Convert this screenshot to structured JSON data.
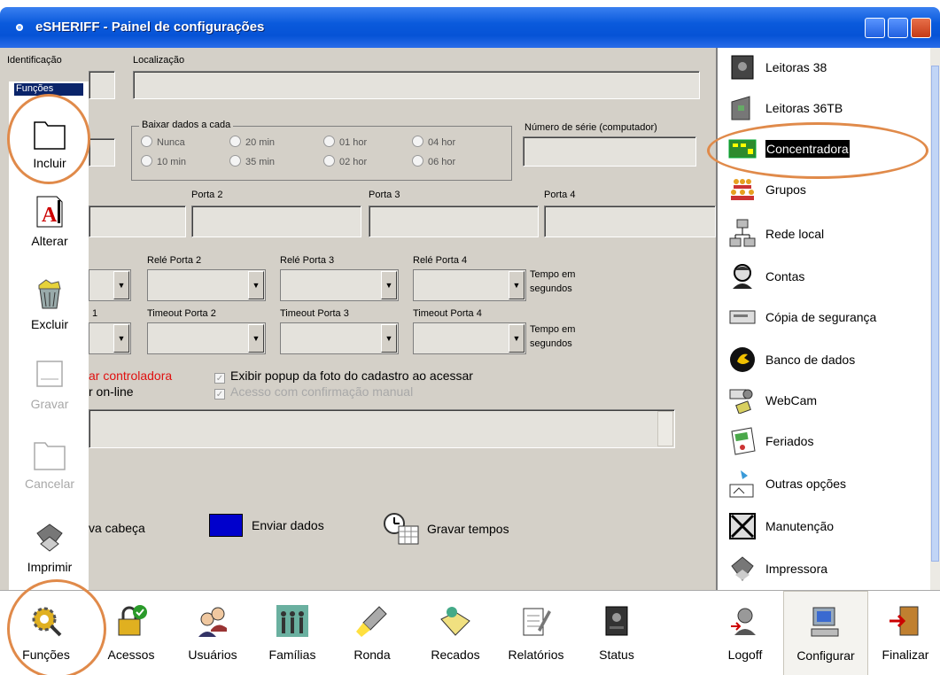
{
  "window": {
    "title": "eSHERIFF - Painel de configurações"
  },
  "form": {
    "identificacao_label": "Identificação",
    "localizacao_label": "Localização",
    "baixar_label": "Baixar dados a cada",
    "radios": [
      "Nunca",
      "20 min",
      "01 hor",
      "04 hor",
      "10 min",
      "35 min",
      "02 hor",
      "06 hor"
    ],
    "serie_label": "Número de série (computador)",
    "portas": [
      "Porta 2",
      "Porta 3",
      "Porta 4"
    ],
    "reles": [
      "Relé Porta 2",
      "Relé Porta 3",
      "Relé Porta 4"
    ],
    "timeouts_first": "1",
    "timeouts": [
      "Timeout Porta 2",
      "Timeout Porta 3",
      "Timeout Porta 4"
    ],
    "tempo_em": "Tempo em",
    "segundos": "segundos",
    "controladora_text": "ar controladora",
    "online_text": "r on-line",
    "popup_text": "Exibir popup da foto do cadastro ao acessar",
    "confirm_text": "Acesso com confirmação manual",
    "cabeca_text": "va cabeça",
    "enviar_text": "Enviar dados",
    "gravar_tempos_text": "Gravar tempos"
  },
  "functions": {
    "header": "Funções",
    "items": [
      "Incluir",
      "Alterar",
      "Excluir",
      "Gravar",
      "Cancelar",
      "Imprimir"
    ]
  },
  "right_list": [
    "Leitoras 38",
    "Leitoras 36TB",
    "Concentradora",
    "Grupos",
    "Rede local",
    "Contas",
    "Cópia de segurança",
    "Banco de dados",
    "WebCam",
    "Feriados",
    "Outras opções",
    "Manutenção",
    "Impressora"
  ],
  "bottom": [
    "Funções",
    "Acessos",
    "Usuários",
    "Famílias",
    "Ronda",
    "Recados",
    "Relatórios",
    "Status",
    "Logoff",
    "Configurar",
    "Finalizar"
  ],
  "colors": {
    "title_bar": "#0653d6",
    "panel": "#d4d0c8",
    "selection": "#000000",
    "annotation": "#e08a4a",
    "enviar": "#0000cc"
  }
}
